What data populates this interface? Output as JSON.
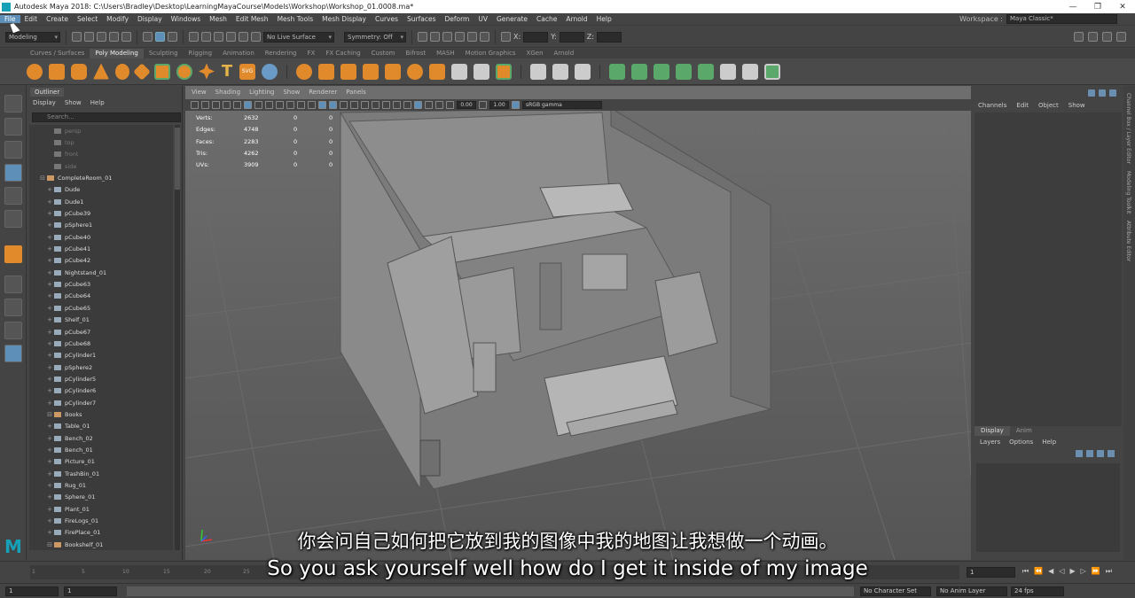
{
  "window": {
    "title": "Autodesk Maya 2018: C:\\Users\\Bradley\\Desktop\\LearningMayaCourse\\Models\\Workshop\\Workshop_01.0008.ma*"
  },
  "menubar": {
    "items": [
      "File",
      "Edit",
      "Create",
      "Select",
      "Modify",
      "Display",
      "Windows",
      "Mesh",
      "Edit Mesh",
      "Mesh Tools",
      "Mesh Display",
      "Curves",
      "Surfaces",
      "Deform",
      "UV",
      "Generate",
      "Cache",
      "Arnold",
      "Help"
    ],
    "workspace_label": "Workspace :",
    "workspace_value": "Maya Classic*"
  },
  "statusline": {
    "mode": "Modeling",
    "live_surface": "No Live Surface",
    "symmetry": "Symmetry: Off",
    "x_label": "X:",
    "y_label": "Y:",
    "z_label": "Z:"
  },
  "shelf": {
    "tabs": [
      "Curves / Surfaces",
      "Poly Modeling",
      "Sculpting",
      "Rigging",
      "Animation",
      "Rendering",
      "FX",
      "FX Caching",
      "Custom",
      "Bifrost",
      "MASH",
      "Motion Graphics",
      "XGen",
      "Arnold"
    ],
    "active_tab": "Poly Modeling"
  },
  "outliner": {
    "tab": "Outliner",
    "menu": [
      "Display",
      "Show",
      "Help"
    ],
    "search_placeholder": "Search...",
    "items": [
      {
        "label": "persp",
        "kind": "cam"
      },
      {
        "label": "top",
        "kind": "cam"
      },
      {
        "label": "front",
        "kind": "cam"
      },
      {
        "label": "side",
        "kind": "cam"
      },
      {
        "label": "CompleteRoom_01",
        "kind": "grp"
      },
      {
        "label": "Dude",
        "kind": "mesh"
      },
      {
        "label": "Dude1",
        "kind": "mesh"
      },
      {
        "label": "pCube39",
        "kind": "mesh"
      },
      {
        "label": "pSphere1",
        "kind": "mesh"
      },
      {
        "label": "pCube40",
        "kind": "mesh"
      },
      {
        "label": "pCube41",
        "kind": "mesh"
      },
      {
        "label": "pCube42",
        "kind": "mesh"
      },
      {
        "label": "Nightstand_01",
        "kind": "mesh"
      },
      {
        "label": "pCube63",
        "kind": "mesh"
      },
      {
        "label": "pCube64",
        "kind": "mesh"
      },
      {
        "label": "pCube65",
        "kind": "mesh"
      },
      {
        "label": "Shelf_01",
        "kind": "mesh"
      },
      {
        "label": "pCube67",
        "kind": "mesh"
      },
      {
        "label": "pCube68",
        "kind": "mesh"
      },
      {
        "label": "pCylinder1",
        "kind": "mesh"
      },
      {
        "label": "pSphere2",
        "kind": "mesh"
      },
      {
        "label": "pCylinder5",
        "kind": "mesh"
      },
      {
        "label": "pCylinder6",
        "kind": "mesh"
      },
      {
        "label": "pCylinder7",
        "kind": "mesh"
      },
      {
        "label": "Books",
        "kind": "grp"
      },
      {
        "label": "Table_01",
        "kind": "mesh"
      },
      {
        "label": "Bench_02",
        "kind": "mesh"
      },
      {
        "label": "Bench_01",
        "kind": "mesh"
      },
      {
        "label": "Picture_01",
        "kind": "mesh"
      },
      {
        "label": "TrashBin_01",
        "kind": "mesh"
      },
      {
        "label": "Rug_01",
        "kind": "mesh"
      },
      {
        "label": "Sphere_01",
        "kind": "mesh"
      },
      {
        "label": "Plant_01",
        "kind": "mesh"
      },
      {
        "label": "FireLogs_01",
        "kind": "mesh"
      },
      {
        "label": "FirePlace_01",
        "kind": "mesh"
      },
      {
        "label": "Bookshelf_01",
        "kind": "grp"
      }
    ]
  },
  "viewport": {
    "menu": [
      "View",
      "Shading",
      "Lighting",
      "Show",
      "Renderer",
      "Panels"
    ],
    "exposure": "0.00",
    "gamma": "1.00",
    "colorspace": "sRGB gamma",
    "hud": [
      {
        "label": "Verts:",
        "v1": "2632",
        "v2": "0",
        "v3": "0"
      },
      {
        "label": "Edges:",
        "v1": "4748",
        "v2": "0",
        "v3": "0"
      },
      {
        "label": "Faces:",
        "v1": "2283",
        "v2": "0",
        "v3": "0"
      },
      {
        "label": "Tris:",
        "v1": "4262",
        "v2": "0",
        "v3": "0"
      },
      {
        "label": "UVs:",
        "v1": "3909",
        "v2": "0",
        "v3": "0"
      }
    ]
  },
  "channelbox": {
    "menu": [
      "Channels",
      "Edit",
      "Object",
      "Show"
    ]
  },
  "layers": {
    "tabs": [
      "Display",
      "Anim"
    ],
    "active_tab": "Display",
    "menu": [
      "Layers",
      "Options",
      "Help"
    ]
  },
  "sidetabs": [
    "Channel Box / Layer Editor",
    "Modeling Toolkit",
    "Attribute Editor"
  ],
  "timeslider": {
    "ticks": [
      "1",
      "5",
      "10",
      "15",
      "20",
      "25"
    ],
    "current_frame": "1"
  },
  "rangeslider": {
    "start": "1",
    "start2": "1",
    "end_label": "No Character Set",
    "anim_layer": "No Anim Layer",
    "fps": "24 fps"
  },
  "subtitles": {
    "zh": "你会问自己如何把它放到我的图像中我的地图让我想做一个动画。",
    "en": "So you ask yourself well how do I get it inside of my image"
  }
}
